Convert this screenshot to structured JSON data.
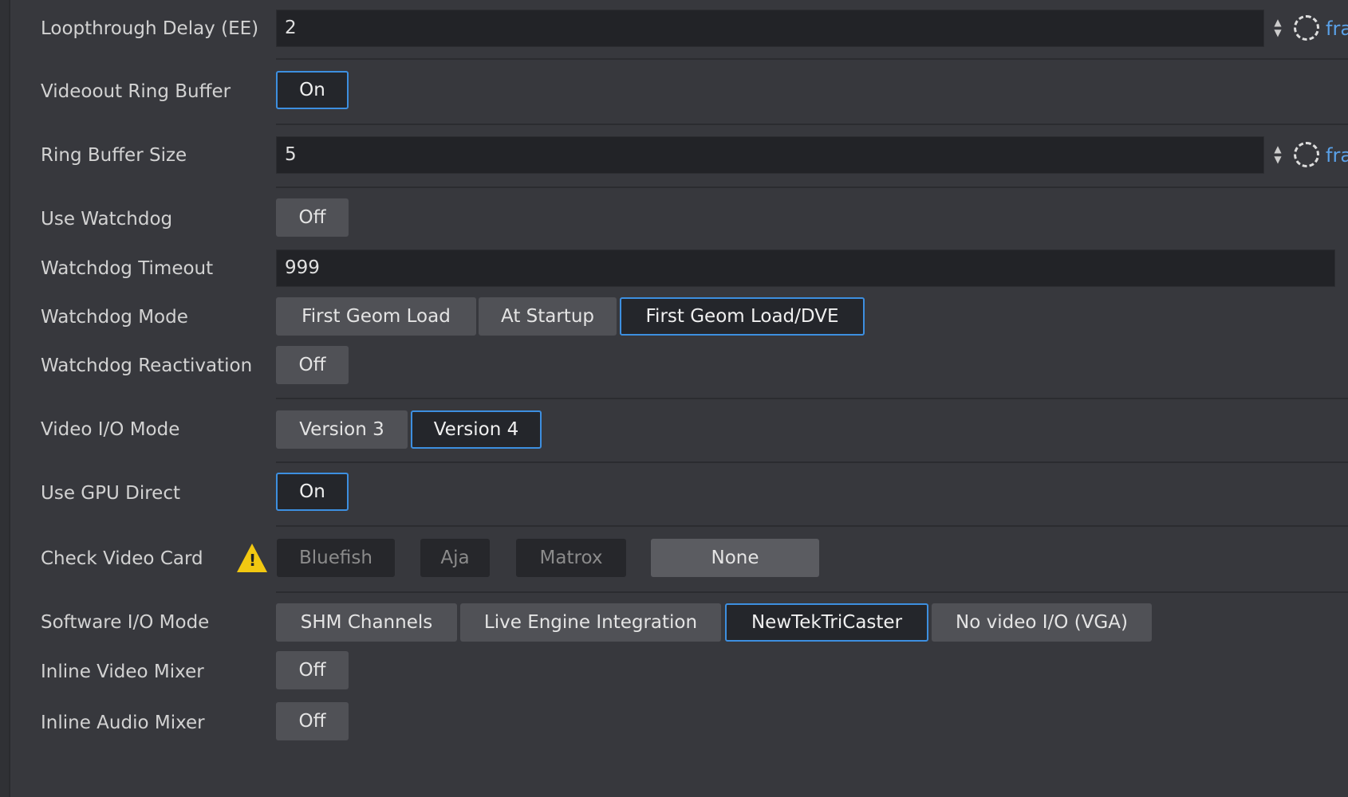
{
  "rows": {
    "loopthrough_delay": {
      "label": "Loopthrough Delay (EE)",
      "value": "2",
      "unit": "fra"
    },
    "videoout_ring_buffer": {
      "label": "Videoout Ring Buffer",
      "value": "On"
    },
    "ring_buffer_size": {
      "label": "Ring Buffer Size",
      "value": "5",
      "unit": "fra"
    },
    "use_watchdog": {
      "label": "Use Watchdog",
      "value": "Off"
    },
    "watchdog_timeout": {
      "label": "Watchdog Timeout",
      "value": "999"
    },
    "watchdog_mode": {
      "label": "Watchdog Mode",
      "options": [
        "First Geom Load",
        "At Startup",
        "First Geom Load/DVE"
      ],
      "selected": "First Geom Load/DVE"
    },
    "watchdog_reactivation": {
      "label": "Watchdog Reactivation",
      "value": "Off"
    },
    "video_io_mode": {
      "label": "Video I/O Mode",
      "options": [
        "Version 3",
        "Version 4"
      ],
      "selected": "Version 4"
    },
    "use_gpu_direct": {
      "label": "Use GPU Direct",
      "value": "On"
    },
    "check_video_card": {
      "label": "Check Video Card",
      "options": [
        "Bluefish",
        "Aja",
        "Matrox",
        "None"
      ],
      "selected": "None",
      "warning_icon": "warning-triangle-icon"
    },
    "software_io_mode": {
      "label": "Software I/O Mode",
      "options": [
        "SHM Channels",
        "Live Engine Integration",
        "NewTekTriCaster",
        "No video I/O (VGA)"
      ],
      "selected": "NewTekTriCaster"
    },
    "inline_video_mixer": {
      "label": "Inline Video Mixer",
      "value": "Off"
    },
    "inline_audio_mixer": {
      "label": "Inline Audio Mixer",
      "value": "Off"
    }
  },
  "colors": {
    "accent": "#3d8fe0",
    "background": "#37383d",
    "warning": "#f2c811"
  }
}
